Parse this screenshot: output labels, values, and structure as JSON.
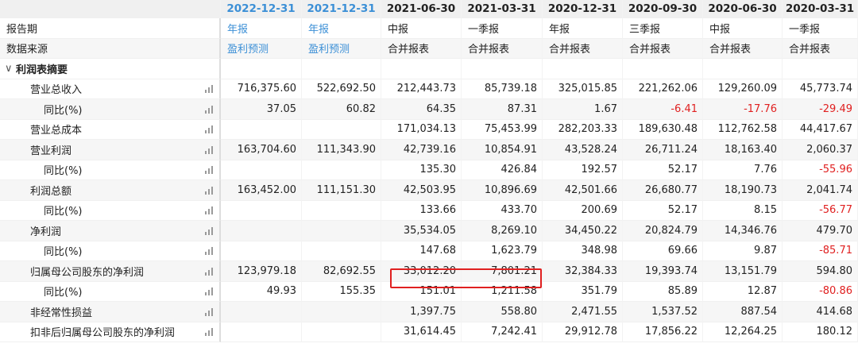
{
  "columns": [
    {
      "date": "2022-12-31",
      "report_type": "年报",
      "source": "盈利预测",
      "forecast": true
    },
    {
      "date": "2021-12-31",
      "report_type": "年报",
      "source": "盈利预测",
      "forecast": true
    },
    {
      "date": "2021-06-30",
      "report_type": "中报",
      "source": "合并报表",
      "forecast": false
    },
    {
      "date": "2021-03-31",
      "report_type": "一季报",
      "source": "合并报表",
      "forecast": false
    },
    {
      "date": "2020-12-31",
      "report_type": "年报",
      "source": "合并报表",
      "forecast": false
    },
    {
      "date": "2020-09-30",
      "report_type": "三季报",
      "source": "合并报表",
      "forecast": false
    },
    {
      "date": "2020-06-30",
      "report_type": "中报",
      "source": "合并报表",
      "forecast": false
    },
    {
      "date": "2020-03-31",
      "report_type": "一季报",
      "source": "合并报表",
      "forecast": false
    }
  ],
  "meta_rows": {
    "report_period_label": "报告期",
    "data_source_label": "数据来源"
  },
  "section": {
    "label": "利润表摘要",
    "expanded": true,
    "chevron_icon": "chevron-down-icon"
  },
  "rows": [
    {
      "label": "营业总收入",
      "indent": 1,
      "values": [
        "716,375.60",
        "522,692.50",
        "212,443.73",
        "85,739.18",
        "325,015.85",
        "221,262.06",
        "129,260.09",
        "45,773.74"
      ]
    },
    {
      "label": "同比(%)",
      "indent": 2,
      "values": [
        "37.05",
        "60.82",
        "64.35",
        "87.31",
        "1.67",
        "-6.41",
        "-17.76",
        "-29.49"
      ]
    },
    {
      "label": "营业总成本",
      "indent": 1,
      "values": [
        "",
        "",
        "171,034.13",
        "75,453.99",
        "282,203.33",
        "189,630.48",
        "112,762.58",
        "44,417.67"
      ]
    },
    {
      "label": "营业利润",
      "indent": 1,
      "values": [
        "163,704.60",
        "111,343.90",
        "42,739.16",
        "10,854.91",
        "43,528.24",
        "26,711.24",
        "18,163.40",
        "2,060.37"
      ]
    },
    {
      "label": "同比(%)",
      "indent": 2,
      "values": [
        "",
        "",
        "135.30",
        "426.84",
        "192.57",
        "52.17",
        "7.76",
        "-55.96"
      ]
    },
    {
      "label": "利润总额",
      "indent": 1,
      "values": [
        "163,452.00",
        "111,151.30",
        "42,503.95",
        "10,896.69",
        "42,501.66",
        "26,680.77",
        "18,190.73",
        "2,041.74"
      ]
    },
    {
      "label": "同比(%)",
      "indent": 2,
      "values": [
        "",
        "",
        "133.66",
        "433.70",
        "200.69",
        "52.17",
        "8.15",
        "-56.77"
      ]
    },
    {
      "label": "净利润",
      "indent": 1,
      "values": [
        "",
        "",
        "35,534.05",
        "8,269.10",
        "34,450.22",
        "20,824.79",
        "14,346.76",
        "479.70"
      ]
    },
    {
      "label": "同比(%)",
      "indent": 2,
      "values": [
        "",
        "",
        "147.68",
        "1,623.79",
        "348.98",
        "69.66",
        "9.87",
        "-85.71"
      ]
    },
    {
      "label": "归属母公司股东的净利润",
      "indent": 1,
      "values": [
        "123,979.18",
        "82,692.55",
        "33,012.20",
        "7,801.21",
        "32,384.33",
        "19,393.74",
        "13,151.79",
        "594.80"
      ]
    },
    {
      "label": "同比(%)",
      "indent": 2,
      "values": [
        "49.93",
        "155.35",
        "151.01",
        "1,211.58",
        "351.79",
        "85.89",
        "12.87",
        "-80.86"
      ]
    },
    {
      "label": "非经常性损益",
      "indent": 1,
      "values": [
        "",
        "",
        "1,397.75",
        "558.80",
        "2,471.55",
        "1,537.52",
        "887.54",
        "414.68"
      ]
    },
    {
      "label": "扣非后归属母公司股东的净利润",
      "indent": 1,
      "values": [
        "",
        "",
        "31,614.45",
        "7,242.41",
        "29,912.78",
        "17,856.22",
        "12,264.25",
        "180.12"
      ]
    }
  ],
  "row_icon": "bar-chart-icon",
  "colors": {
    "forecast_header": "#3b8fd6",
    "negative": "#e02020",
    "highlight_border": "#e02020"
  },
  "highlight": {
    "row_label": "归属母公司股东的净利润",
    "columns": [
      "2021-06-30",
      "2021-03-31"
    ]
  }
}
